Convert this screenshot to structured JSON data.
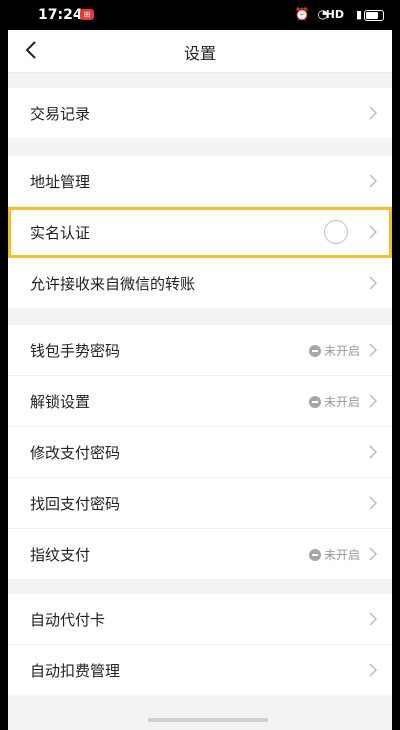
{
  "status_bar": {
    "time": "17:24",
    "notification_badge": "⊞",
    "network": "HD"
  },
  "header": {
    "title": "设置",
    "back_icon": "chevron-left-icon"
  },
  "groups": [
    {
      "items": [
        {
          "label": "交易记录"
        }
      ]
    },
    {
      "items": [
        {
          "label": "地址管理"
        },
        {
          "label": "实名认证",
          "highlighted": true
        },
        {
          "label": "允许接收来自微信的转账"
        }
      ]
    },
    {
      "items": [
        {
          "label": "钱包手势密码",
          "status": "未开启"
        },
        {
          "label": "解锁设置",
          "status": "未开启"
        },
        {
          "label": "修改支付密码"
        },
        {
          "label": "找回支付密码"
        },
        {
          "label": "指纹支付",
          "status": "未开启"
        }
      ]
    },
    {
      "items": [
        {
          "label": "自动代付卡"
        },
        {
          "label": "自动扣费管理"
        }
      ]
    }
  ],
  "colors": {
    "highlight": "#f2c12e",
    "background": "#f3f3f3"
  }
}
